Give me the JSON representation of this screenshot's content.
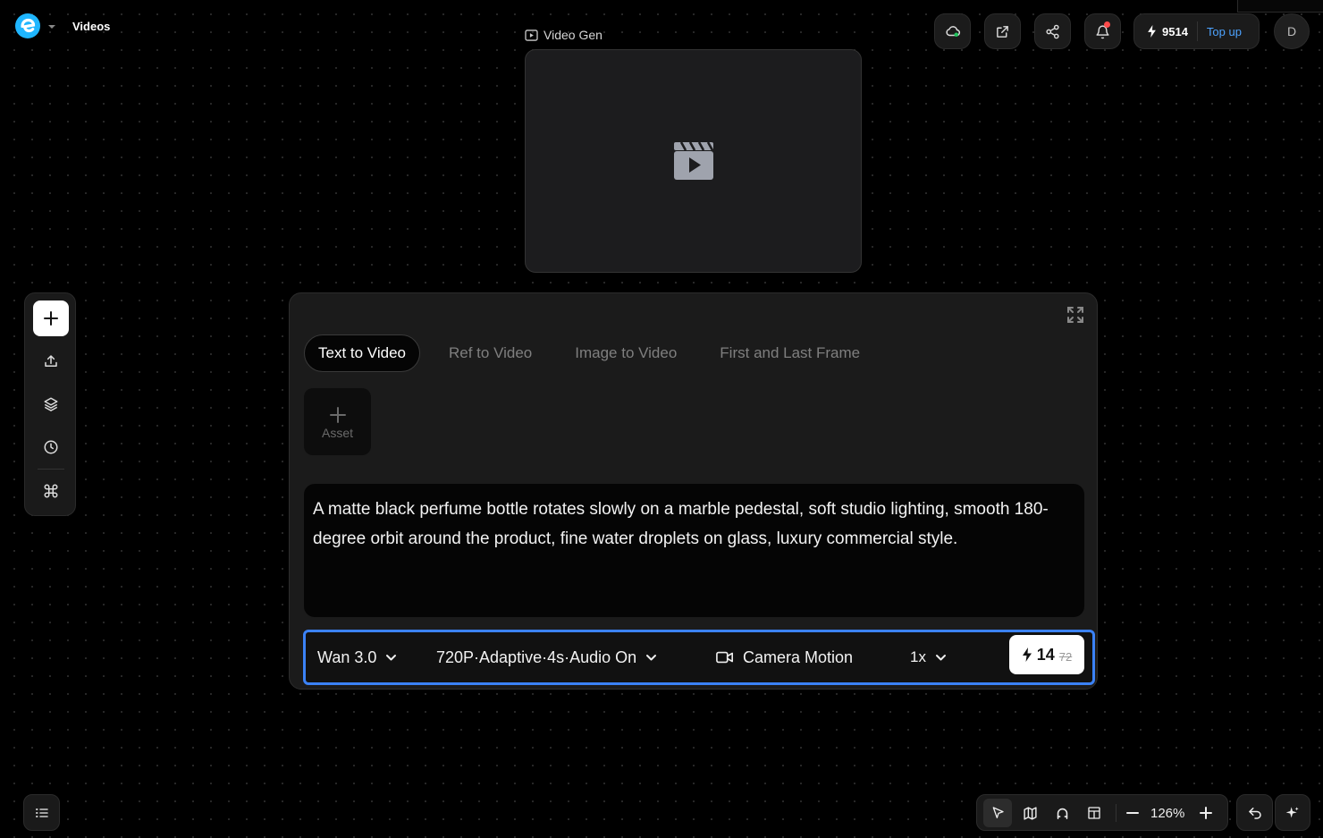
{
  "header": {
    "app_title": "Videos",
    "credits": {
      "count": "9514",
      "topup_label": "Top up"
    },
    "avatar_initial": "D",
    "buttons": [
      "cloud-icon",
      "external-link-icon",
      "share-icon",
      "bell-icon"
    ]
  },
  "node": {
    "label": "Video Gen",
    "placeholder_icon": "clapperboard-play-icon"
  },
  "left_toolbar": {
    "items": [
      "plus-icon",
      "upload-icon",
      "layers-icon",
      "history-icon",
      "command-icon"
    ]
  },
  "panel": {
    "tabs": [
      {
        "label": "Text to Video",
        "active": true
      },
      {
        "label": "Ref to Video",
        "active": false
      },
      {
        "label": "Image to Video",
        "active": false
      },
      {
        "label": "First and Last Frame",
        "active": false
      }
    ],
    "asset_label": "Asset",
    "prompt": "A matte black perfume bottle rotates slowly on a marble pedestal, soft studio lighting, smooth 180-degree orbit around the product, fine water droplets on glass, luxury commercial style.",
    "controls": {
      "model": "Wan 3.0",
      "settings": "720P·Adaptive·4s·Audio On",
      "camera_motion": "Camera Motion",
      "quantity": "1x",
      "cost": "14",
      "original_cost": "72"
    }
  },
  "bottom_bar": {
    "zoom": "126%",
    "tools": [
      "pointer-icon",
      "map-icon",
      "magnet-icon",
      "layout-icon"
    ]
  },
  "colors": {
    "accent": "#3b82f6",
    "topup": "#4da3ff",
    "notification": "#ff4b4b"
  }
}
